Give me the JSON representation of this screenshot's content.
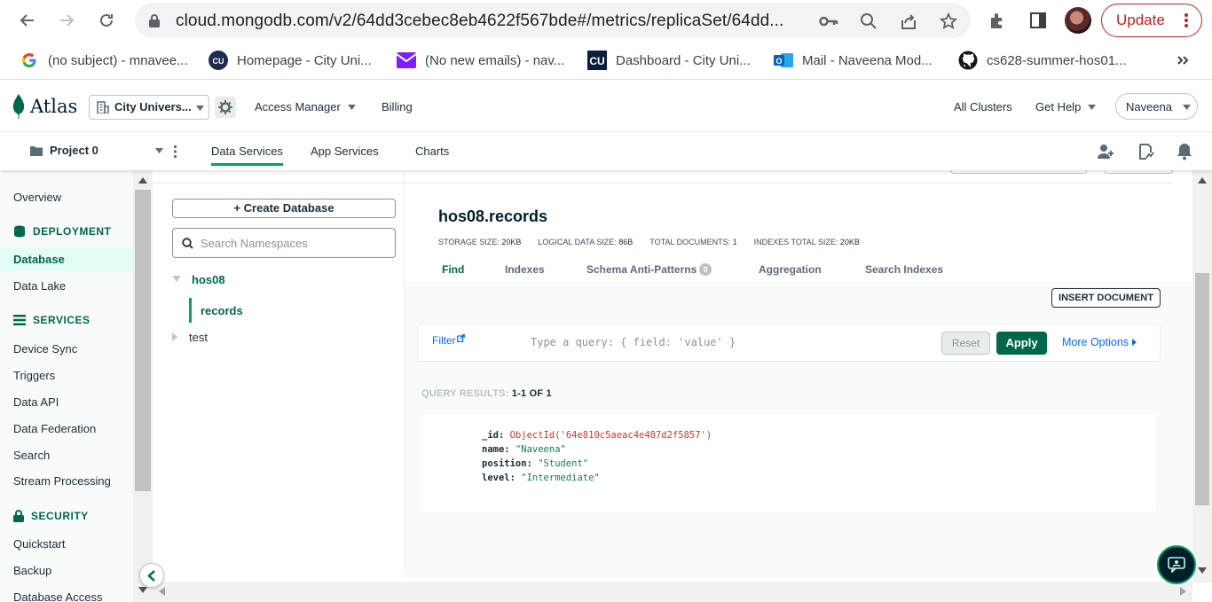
{
  "browser": {
    "url": "cloud.mongodb.com/v2/64dd3cebec8eb4622f567bde#/metrics/replicaSet/64dd...",
    "update_label": "Update"
  },
  "bookmarks": [
    {
      "label": "(no subject) - mnavee...",
      "icon": "google-icon"
    },
    {
      "label": "Homepage - City Uni...",
      "icon": "cu-icon"
    },
    {
      "label": "(No new emails) - nav...",
      "icon": "mail-icon"
    },
    {
      "label": "Dashboard - City Uni...",
      "icon": "cu-square-icon"
    },
    {
      "label": "Mail - Naveena Mod...",
      "icon": "outlook-icon"
    },
    {
      "label": "cs628-summer-hos01...",
      "icon": "github-icon"
    }
  ],
  "atlas_nav": {
    "logo_text": "Atlas",
    "org_name": "City Univers...",
    "access_manager": "Access Manager",
    "billing": "Billing",
    "all_clusters": "All Clusters",
    "get_help": "Get Help",
    "user": "Naveena"
  },
  "project_bar": {
    "project": "Project 0",
    "tabs": [
      "Data Services",
      "App Services",
      "Charts"
    ]
  },
  "sidebar": {
    "overview": "Overview",
    "deployment_heading": "DEPLOYMENT",
    "database": "Database",
    "data_lake": "Data Lake",
    "services_heading": "SERVICES",
    "device_sync": "Device Sync",
    "triggers": "Triggers",
    "data_api": "Data API",
    "data_federation": "Data Federation",
    "search": "Search",
    "stream_processing": "Stream Processing",
    "security_heading": "SECURITY",
    "quickstart": "Quickstart",
    "backup": "Backup",
    "database_access": "Database Access"
  },
  "namespaces": {
    "create_label": "+ Create Database",
    "search_placeholder": "Search Namespaces",
    "db": "hos08",
    "collection": "records",
    "other_db": "test"
  },
  "collection": {
    "title": "hos08.records",
    "stats": {
      "storage_label": "STORAGE SIZE:",
      "storage_value": "20KB",
      "logical_label": "LOGICAL DATA SIZE:",
      "logical_value": "86B",
      "docs_label": "TOTAL DOCUMENTS:",
      "docs_value": "1",
      "indexes_label": "INDEXES TOTAL SIZE:",
      "indexes_value": "20KB"
    },
    "tabs": [
      "Find",
      "Indexes",
      "Schema Anti-Patterns",
      "Aggregation",
      "Search Indexes"
    ],
    "schema_badge": "0",
    "insert_label": "INSERT DOCUMENT",
    "filter_label": "Filter",
    "query_placeholder": "Type a query: { field: 'value' }",
    "reset_label": "Reset",
    "apply_label": "Apply",
    "more_options": "More Options",
    "results_label": "QUERY RESULTS:",
    "results_value": "1-1 OF 1",
    "document": {
      "id_key": "_id:",
      "id_value": "ObjectId('64e810c5aeac4e487d2f5857')",
      "name_key": "name:",
      "name_value": "\"Naveena\"",
      "position_key": "position:",
      "position_value": "\"Student\"",
      "level_key": "level:",
      "level_value": "\"Intermediate\""
    }
  },
  "colors": {
    "brand_green": "#00684a",
    "accent_green": "#00a35c",
    "link_blue": "#016bf8",
    "update_red": "#c5221f"
  }
}
